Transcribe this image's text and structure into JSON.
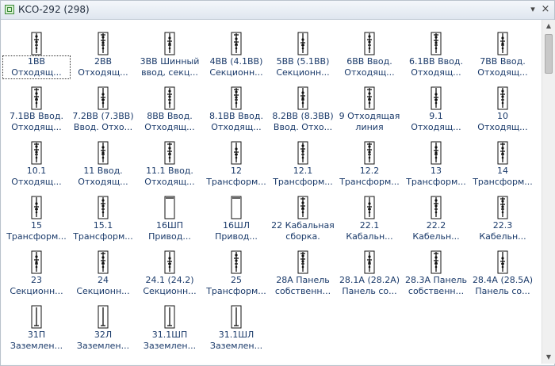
{
  "window": {
    "title": "КСО-292 (298)",
    "menu_icon": "dropdown-arrow-icon",
    "close_icon": "close-icon"
  },
  "items": [
    {
      "l1": "1ВВ",
      "l2": "Отходящ..."
    },
    {
      "l1": "2ВВ",
      "l2": "Отходящ..."
    },
    {
      "l1": "3ВВ Шинный",
      "l2": "ввод, секц..."
    },
    {
      "l1": "4ВВ (4.1ВВ)",
      "l2": "Секционн..."
    },
    {
      "l1": "5ВВ (5.1ВВ)",
      "l2": "Секционн..."
    },
    {
      "l1": "6ВВ Ввод.",
      "l2": "Отходящ..."
    },
    {
      "l1": "6.1ВВ Ввод.",
      "l2": "Отходящ..."
    },
    {
      "l1": "7ВВ Ввод.",
      "l2": "Отходящ..."
    },
    {
      "l1": "7.1ВВ Ввод.",
      "l2": "Отходящ..."
    },
    {
      "l1": "7.2ВВ (7.3ВВ)",
      "l2": "Ввод. Отхо..."
    },
    {
      "l1": "8ВВ Ввод.",
      "l2": "Отходящ..."
    },
    {
      "l1": "8.1ВВ Ввод.",
      "l2": "Отходящ..."
    },
    {
      "l1": "8.2ВВ (8.3ВВ)",
      "l2": "Ввод. Отхо..."
    },
    {
      "l1": "9 Отходящая",
      "l2": "линия"
    },
    {
      "l1": "9.1",
      "l2": "Отходящ..."
    },
    {
      "l1": "10",
      "l2": "Отходящ..."
    },
    {
      "l1": "10.1",
      "l2": "Отходящ..."
    },
    {
      "l1": "11 Ввод.",
      "l2": "Отходящ..."
    },
    {
      "l1": "11.1 Ввод.",
      "l2": "Отходящ..."
    },
    {
      "l1": "12",
      "l2": "Трансформ..."
    },
    {
      "l1": "12.1",
      "l2": "Трансформ..."
    },
    {
      "l1": "12.2",
      "l2": "Трансформ..."
    },
    {
      "l1": "13",
      "l2": "Трансформ..."
    },
    {
      "l1": "14",
      "l2": "Трансформ..."
    },
    {
      "l1": "15",
      "l2": "Трансформ..."
    },
    {
      "l1": "15.1",
      "l2": "Трансформ..."
    },
    {
      "l1": "16ШП",
      "l2": "Привод..."
    },
    {
      "l1": "16ШЛ",
      "l2": "Привод..."
    },
    {
      "l1": "22 Кабальная",
      "l2": "сборка."
    },
    {
      "l1": "22.1",
      "l2": "Кабальн..."
    },
    {
      "l1": "22.2",
      "l2": "Кабельн..."
    },
    {
      "l1": "22.3",
      "l2": "Кабельн..."
    },
    {
      "l1": "23",
      "l2": "Секционн..."
    },
    {
      "l1": "24",
      "l2": "Секционн..."
    },
    {
      "l1": "24.1 (24.2)",
      "l2": "Секционн..."
    },
    {
      "l1": "25",
      "l2": "Трансформ..."
    },
    {
      "l1": "28А Панель",
      "l2": "собственн..."
    },
    {
      "l1": "28.1А (28.2А)",
      "l2": "Панель со..."
    },
    {
      "l1": "28.3А Панель",
      "l2": "собственн..."
    },
    {
      "l1": "28.4А (28.5А)",
      "l2": "Панель со..."
    },
    {
      "l1": "31П",
      "l2": "Заземлен..."
    },
    {
      "l1": "32Л",
      "l2": "Заземлен..."
    },
    {
      "l1": "31.1ШП",
      "l2": "Заземлен..."
    },
    {
      "l1": "31.1ШЛ",
      "l2": "Заземлен..."
    }
  ]
}
